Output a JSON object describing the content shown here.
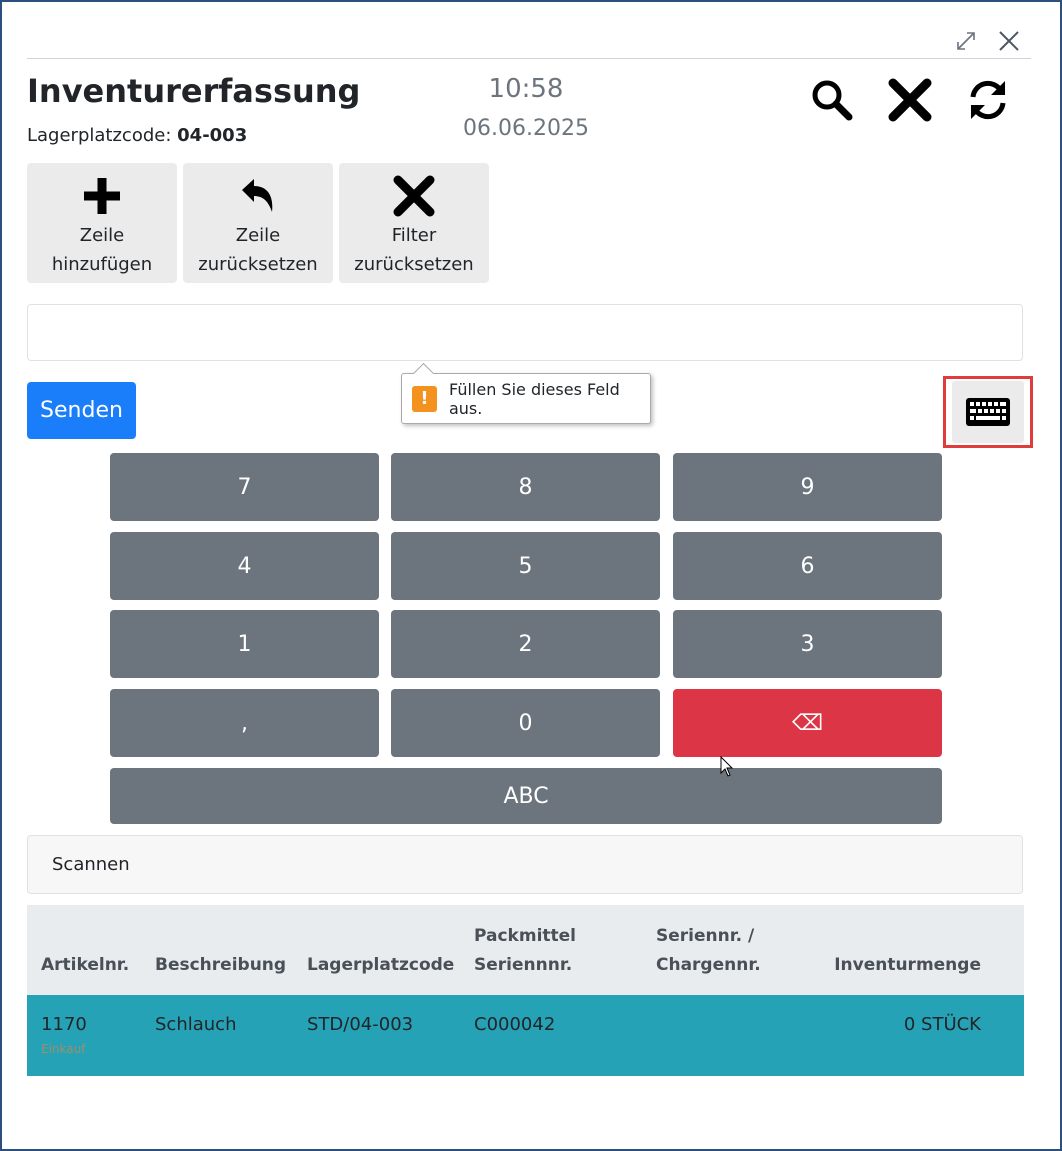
{
  "window": {
    "maximize_icon": "expand-icon",
    "close_icon": "close-icon"
  },
  "header": {
    "title": "Inventurerfassung",
    "location_label": "Lagerplatzcode:",
    "location_value": "04-003",
    "time": "10:58",
    "date": "06.06.2025"
  },
  "header_actions": [
    {
      "icon": "search-icon"
    },
    {
      "icon": "close-x-icon"
    },
    {
      "icon": "refresh-icon"
    }
  ],
  "toolbar": {
    "add_line": {
      "line1": "Zeile",
      "line2": "hinzufügen"
    },
    "reset_line": {
      "line1": "Zeile",
      "line2": "zurücksetzen"
    },
    "reset_filter": {
      "line1": "Filter",
      "line2": "zurücksetzen"
    }
  },
  "input": {
    "value": "",
    "validation_message": "Füllen Sie dieses Feld aus."
  },
  "send_button": "Senden",
  "keypad": {
    "k7": "7",
    "k8": "8",
    "k9": "9",
    "k4": "4",
    "k5": "5",
    "k6": "6",
    "k1": "1",
    "k2": "2",
    "k3": "3",
    "comma": ",",
    "k0": "0",
    "backspace": "⌫",
    "abc": "ABC"
  },
  "scan": {
    "label": "Scannen"
  },
  "table": {
    "headers": {
      "artikel": "Artikelnr.",
      "beschreibung": "Beschreibung",
      "lagerplatz": "Lagerplatzcode",
      "packmittel_1": "Packmittel",
      "packmittel_2": "Seriennnr.",
      "serien_1": "Seriennr. /",
      "serien_2": "Chargennr.",
      "menge": "Inventurmenge"
    },
    "rows": [
      {
        "artikel": "1170",
        "subtext": "Einkauf",
        "beschreibung": "Schlauch",
        "lagerplatz": "STD/04-003",
        "packmittel": "C000042",
        "serien": "",
        "menge": "0 STÜCK"
      }
    ]
  },
  "colors": {
    "primary": "#1a7efb",
    "key_gray": "#6c757d",
    "danger": "#dc3545",
    "row_teal": "#25a2b5",
    "highlight_border": "#e03c3c"
  }
}
